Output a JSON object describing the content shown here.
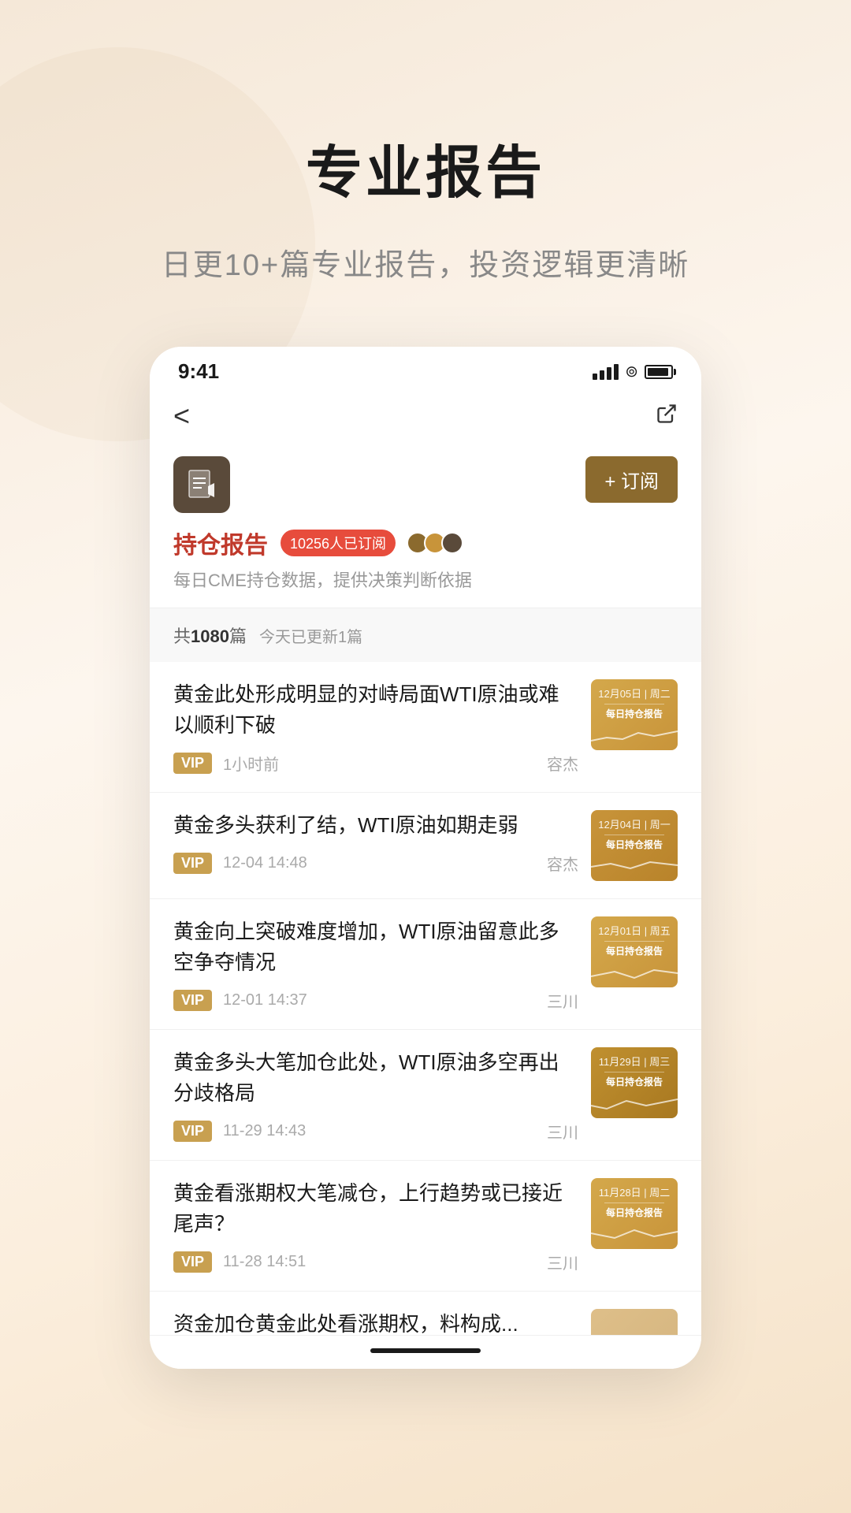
{
  "page": {
    "title": "专业报告",
    "subtitle": "日更10+篇专业报告，投资逻辑更清晰",
    "bg_color_start": "#f5e8d8",
    "bg_color_end": "#fbeedd"
  },
  "status_bar": {
    "time": "9:41",
    "signal_label": "signal",
    "wifi_label": "wifi",
    "battery_label": "battery"
  },
  "nav": {
    "back_label": "‹",
    "share_label": "⎋"
  },
  "channel": {
    "icon_alt": "report-icon",
    "subscribe_label": "+ 订阅",
    "name": "持仓报告",
    "subscriber_count": "10256人已订阅",
    "description": "每日CME持仓数据，提供决策判断依据"
  },
  "article_list": {
    "total_label": "共1080篇",
    "today_update_label": "今天已更新1篇",
    "articles": [
      {
        "id": 1,
        "title": "黄金此处形成明显的对峙局面WTI原油或难以顺利下破",
        "vip": true,
        "time": "1小时前",
        "author": "容杰",
        "thumb_date1": "12月05日 | 周二",
        "thumb_title": "每日持仓报告"
      },
      {
        "id": 2,
        "title": "黄金多头获利了结，WTI原油如期走弱",
        "vip": true,
        "time": "12-04 14:48",
        "author": "容杰",
        "thumb_date1": "12月04日 | 周一",
        "thumb_title": "每日持仓报告"
      },
      {
        "id": 3,
        "title": "黄金向上突破难度增加，WTI原油留意此多空争夺情况",
        "vip": true,
        "time": "12-01 14:37",
        "author": "三川",
        "thumb_date1": "12月01日 | 周五",
        "thumb_title": "每日持仓报告"
      },
      {
        "id": 4,
        "title": "黄金多头大笔加仓此处，WTI原油多空再出分歧格局",
        "vip": true,
        "time": "11-29 14:43",
        "author": "三川",
        "thumb_date1": "11月29日 | 周三",
        "thumb_title": "每日持仓报告"
      },
      {
        "id": 5,
        "title": "黄金看涨期权大笔减仓，上行趋势或已接近尾声？",
        "vip": true,
        "time": "11-28 14:51",
        "author": "三川",
        "thumb_date1": "11月28日 | 周二",
        "thumb_title": "每日持仓报告"
      },
      {
        "id": 6,
        "title": "资金加仓黄金此处看涨期权，料构成...",
        "vip": true,
        "time": "",
        "author": "",
        "thumb_date1": "",
        "thumb_title": ""
      }
    ]
  },
  "vip_badge_label": "VIP",
  "colors": {
    "brand_gold": "#8b6a2e",
    "brand_red": "#c0392b",
    "badge_red": "#e74c3c",
    "thumb_bg1": "#c8943a",
    "thumb_bg2": "#d4a84b"
  }
}
